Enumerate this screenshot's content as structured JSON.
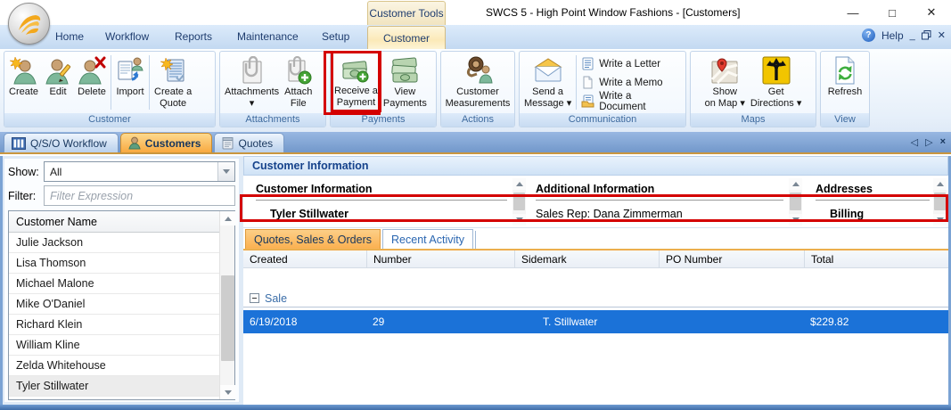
{
  "window": {
    "title": "SWCS 5 - High Point Window Fashions - [Customers]",
    "context_tab_header": "Customer Tools",
    "controls": {
      "minimize": "—",
      "maximize": "□",
      "close": "✕"
    },
    "mdi": {
      "help": "Help",
      "minimize": "_",
      "close": "✕"
    }
  },
  "ribbon": {
    "tabs": [
      "Home",
      "Workflow",
      "Reports",
      "Maintenance",
      "Setup",
      "Customer"
    ],
    "groups": [
      {
        "label": "Customer",
        "buttons": [
          {
            "label": "Create"
          },
          {
            "label": "Edit"
          },
          {
            "label": "Delete"
          },
          {
            "label": "Import"
          },
          {
            "label": "Create a\nQuote"
          }
        ]
      },
      {
        "label": "Attachments",
        "buttons": [
          {
            "label": "Attachments\n▾"
          },
          {
            "label": "Attach\nFile"
          }
        ]
      },
      {
        "label": "Payments",
        "buttons": [
          {
            "label": "Receive a\nPayment"
          },
          {
            "label": "View\nPayments"
          }
        ]
      },
      {
        "label": "Actions",
        "buttons": [
          {
            "label": "Customer\nMeasurements"
          }
        ]
      },
      {
        "label": "Communication",
        "buttons": [
          {
            "label": "Send a\nMessage ▾"
          }
        ],
        "links": [
          "Write a Letter",
          "Write a Memo",
          "Write a Document"
        ]
      },
      {
        "label": "Maps",
        "buttons": [
          {
            "label": "Show\non Map ▾"
          },
          {
            "label": "Get\nDirections ▾"
          }
        ]
      },
      {
        "label": "View",
        "buttons": [
          {
            "label": "Refresh"
          }
        ]
      }
    ]
  },
  "doc_tabs": {
    "tabs": [
      {
        "label": "Q/S/O Workflow"
      },
      {
        "label": "Customers"
      },
      {
        "label": "Quotes"
      }
    ],
    "nav": {
      "prev": "◁",
      "next": "▷",
      "close": "×"
    }
  },
  "left_panel": {
    "show_label": "Show:",
    "show_value": "All",
    "filter_label": "Filter:",
    "filter_placeholder": "Filter Expression",
    "list_header": "Customer Name",
    "customers": [
      "Julie Jackson",
      "Lisa Thomson",
      "Michael Malone",
      "Mike O'Daniel",
      "Richard Klein",
      "William Kline",
      "Zelda Whitehouse",
      "Tyler Stillwater"
    ],
    "selected_customer": "Tyler Stillwater"
  },
  "right_panel": {
    "header": "Customer Information",
    "sections": [
      {
        "title": "Customer Information",
        "value": "Tyler Stillwater"
      },
      {
        "title": "Additional Information",
        "value": "Sales Rep: Dana Zimmerman"
      },
      {
        "title": "Addresses",
        "value": "Billing"
      }
    ],
    "subtabs": [
      "Quotes, Sales & Orders",
      "Recent Activity"
    ],
    "grid": {
      "columns": [
        "Created",
        "Number",
        "Sidemark",
        "PO Number",
        "Total"
      ],
      "group_label": "Sale",
      "selected_row": {
        "created": "6/19/2018",
        "number": "29",
        "sidemark": "T. Stillwater",
        "po_number": "",
        "total": "$229.82"
      }
    }
  },
  "colors": {
    "annotation_red": "#d40000",
    "selection_blue": "#1b72d8",
    "active_tab_orange": "#f8a940",
    "header_navy": "#15428b"
  }
}
